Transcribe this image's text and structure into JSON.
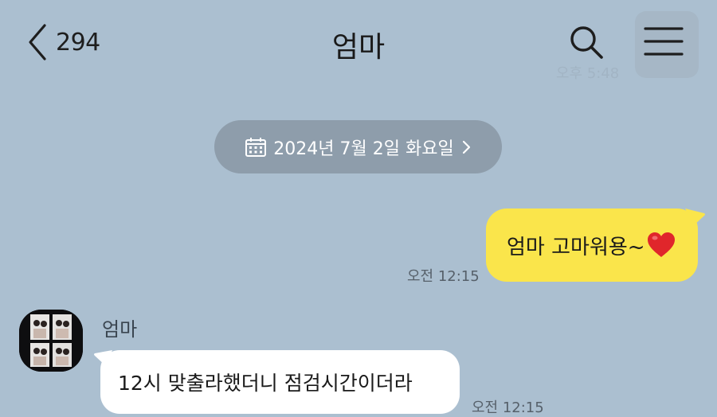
{
  "header": {
    "back_count": "294",
    "title": "엄마",
    "ghost_time": "오후 5:48"
  },
  "date_separator": {
    "label": "2024년 7월 2일 화요일"
  },
  "messages": [
    {
      "sender": "me",
      "text": "엄마 고마워용~",
      "emoji": "red-heart",
      "time": "오전 12:15",
      "bubble_color": "#fae54b"
    },
    {
      "sender": "엄마",
      "text": "12시 맞출라했더니 점검시간이더라",
      "time": "오전 12:15",
      "bubble_color": "#ffffff"
    }
  ],
  "colors": {
    "background": "#abbfd0",
    "date_pill": "#8e9dab",
    "my_bubble": "#fae54b",
    "other_bubble": "#ffffff"
  }
}
